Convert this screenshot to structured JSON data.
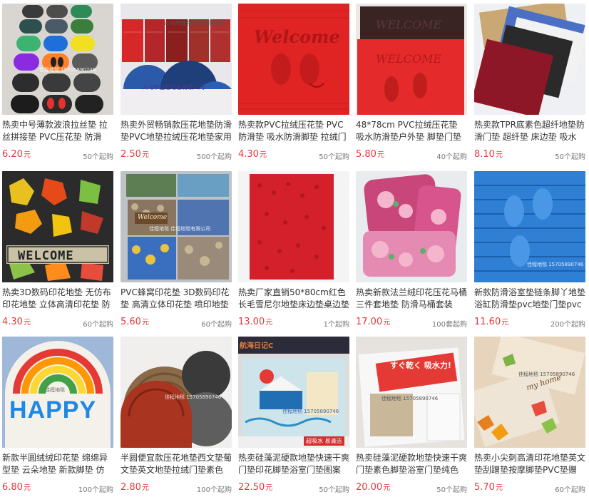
{
  "products": [
    {
      "title": "热卖中号薄款波浪拉丝垫 拉丝拼接垫 PVC压花垫 防滑",
      "price_main": "6.20",
      "price_unit": "元",
      "moq": "50个起购",
      "watermark": "佳程地毯 15705890746"
    },
    {
      "title": "热卖外贸畅销款压花地垫防滑垫PVC地垫拉绒压花地垫家用",
      "price_main": "2.50",
      "price_unit": "元",
      "moq": "500个起购",
      "watermark_top": "义乌市佳程地毯有限公司",
      "watermark": "义乌市佳程地毯有限公司"
    },
    {
      "title": "热卖款PVC拉绒压花垫 PVC防滑垫 吸水防滑脚垫 拉绒门",
      "price_main": "4.30",
      "price_unit": "元",
      "moq": "50个起购",
      "mat_text": "Welcome"
    },
    {
      "title": "48*78cm PVC拉绒压花垫 吸水防滑垫户外垫 脚垫门垫",
      "price_main": "5.80",
      "price_unit": "元",
      "moq": "40个起购",
      "mat_text": "WELCOME"
    },
    {
      "title": "热卖款TPR底素色超纤地垫防滑门垫 超纤垫 床边垫 吸水",
      "price_main": "8.10",
      "price_unit": "元",
      "moq": "50个起购"
    },
    {
      "title": "热卖3D数码印花地垫 无仿布印花地垫 立体高清印花垫 防",
      "price_main": "4.30",
      "price_unit": "元",
      "moq": "60个起购",
      "mat_text": "WELCOME"
    },
    {
      "title": "PVC蜂窝印花垫 3D数码印花垫 高清立体印花垫 喷印地垫",
      "price_main": "5.60",
      "price_unit": "元",
      "moq": "60个起购",
      "watermark": "佳程地毯 佳程地毯有限公司",
      "mat_text": "Welcome"
    },
    {
      "title": "热卖厂家直销50*80cm红色长毛雪尼尔地垫床边垫桌边垫",
      "price_main": "13.00",
      "price_unit": "元",
      "moq": "1个起购"
    },
    {
      "title": "热卖新款法兰绒印花压花马桶三件套地垫 防滑马桶套装",
      "price_main": "17.00",
      "price_unit": "元",
      "moq": "100套起购"
    },
    {
      "title": "新款防滑浴室垫链条脚丫地垫浴缸防滑垫pvc地垫门垫pvc",
      "price_main": "11.60",
      "price_unit": "元",
      "moq": "200个起购",
      "watermark": "佳程地毯 15705890746"
    },
    {
      "title": "新款半圆绒绒印花垫 绵绵异型垫 云朵地垫 新款脚垫 仿",
      "price_main": "6.80",
      "price_unit": "元",
      "moq": "100个起购",
      "watermark": "佳程地毯",
      "mat_text": "HAPPY"
    },
    {
      "title": "半圆便宜款压花地垫西文垫葡文垫英文地垫拉绒门垫素色",
      "price_main": "2.80",
      "price_unit": "元",
      "moq": "100个起购",
      "watermark": "佳程地毯 15705890746"
    },
    {
      "title": "热卖硅藻泥硬款地垫快速干爽门垫印花脚垫浴室门垫图案",
      "price_main": "22.50",
      "price_unit": "元",
      "moq": "50个起购",
      "banner_top": "航海日记C",
      "banner_bottom": "超吸水 易清洁",
      "watermark": "佳程地毯 15705890746"
    },
    {
      "title": "热卖硅藻泥硬款地垫快速干爽门垫素色脚垫浴室门垫纯色",
      "price_main": "20.00",
      "price_unit": "元",
      "moq": "50个起购",
      "pack_text": "すぐ乾く 吸水力!",
      "watermark": "佳程地毯 15705890746"
    },
    {
      "title": "热卖小尖刺高清印花地垫英文垫刮蹭垫按摩脚垫PVC垫赠",
      "price_main": "5.70",
      "price_unit": "元",
      "moq": "60个起购",
      "watermark": "佳程地毯 15705890746",
      "mat_text": "my home"
    }
  ],
  "colors": {
    "price": "#e4393c",
    "moq": "#777777",
    "title": "#333333"
  }
}
